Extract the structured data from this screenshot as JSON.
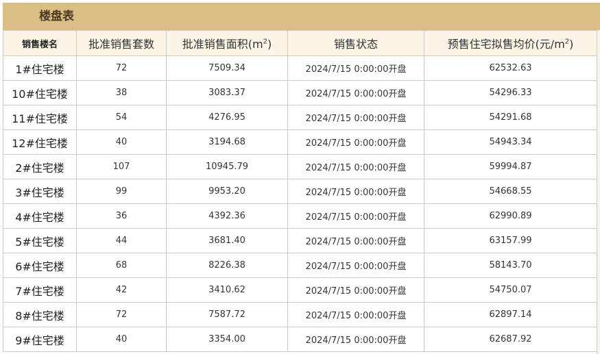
{
  "title": "楼盘表",
  "headers": {
    "name": "销售楼名",
    "units": "批准销售套数",
    "area_prefix": "批准销售面积(m",
    "area_sup": "2",
    "area_suffix": ")",
    "status": "销售状态",
    "price_prefix": "预售住宅拟售均价(元/m",
    "price_sup": "2",
    "price_suffix": ")"
  },
  "rows": [
    {
      "name": "1#住宅楼",
      "units": "72",
      "area": "7509.34",
      "status": "2024/7/15 0:00:00开盘",
      "price": "62532.63"
    },
    {
      "name": "10#住宅楼",
      "units": "38",
      "area": "3083.37",
      "status": "2024/7/15 0:00:00开盘",
      "price": "54296.33"
    },
    {
      "name": "11#住宅楼",
      "units": "54",
      "area": "4276.95",
      "status": "2024/7/15 0:00:00开盘",
      "price": "54291.68"
    },
    {
      "name": "12#住宅楼",
      "units": "40",
      "area": "3194.68",
      "status": "2024/7/15 0:00:00开盘",
      "price": "54943.34"
    },
    {
      "name": "2#住宅楼",
      "units": "107",
      "area": "10945.79",
      "status": "2024/7/15 0:00:00开盘",
      "price": "59994.87"
    },
    {
      "name": "3#住宅楼",
      "units": "99",
      "area": "9953.20",
      "status": "2024/7/15 0:00:00开盘",
      "price": "54668.55"
    },
    {
      "name": "4#住宅楼",
      "units": "36",
      "area": "4392.36",
      "status": "2024/7/15 0:00:00开盘",
      "price": "62990.89"
    },
    {
      "name": "5#住宅楼",
      "units": "44",
      "area": "3681.40",
      "status": "2024/7/15 0:00:00开盘",
      "price": "63157.99"
    },
    {
      "name": "6#住宅楼",
      "units": "68",
      "area": "8226.38",
      "status": "2024/7/15 0:00:00开盘",
      "price": "58143.70"
    },
    {
      "name": "7#住宅楼",
      "units": "42",
      "area": "3410.62",
      "status": "2024/7/15 0:00:00开盘",
      "price": "54750.07"
    },
    {
      "name": "8#住宅楼",
      "units": "72",
      "area": "7587.72",
      "status": "2024/7/15 0:00:00开盘",
      "price": "62897.14"
    },
    {
      "name": "9#住宅楼",
      "units": "40",
      "area": "3354.00",
      "status": "2024/7/15 0:00:00开盘",
      "price": "62687.92"
    }
  ]
}
